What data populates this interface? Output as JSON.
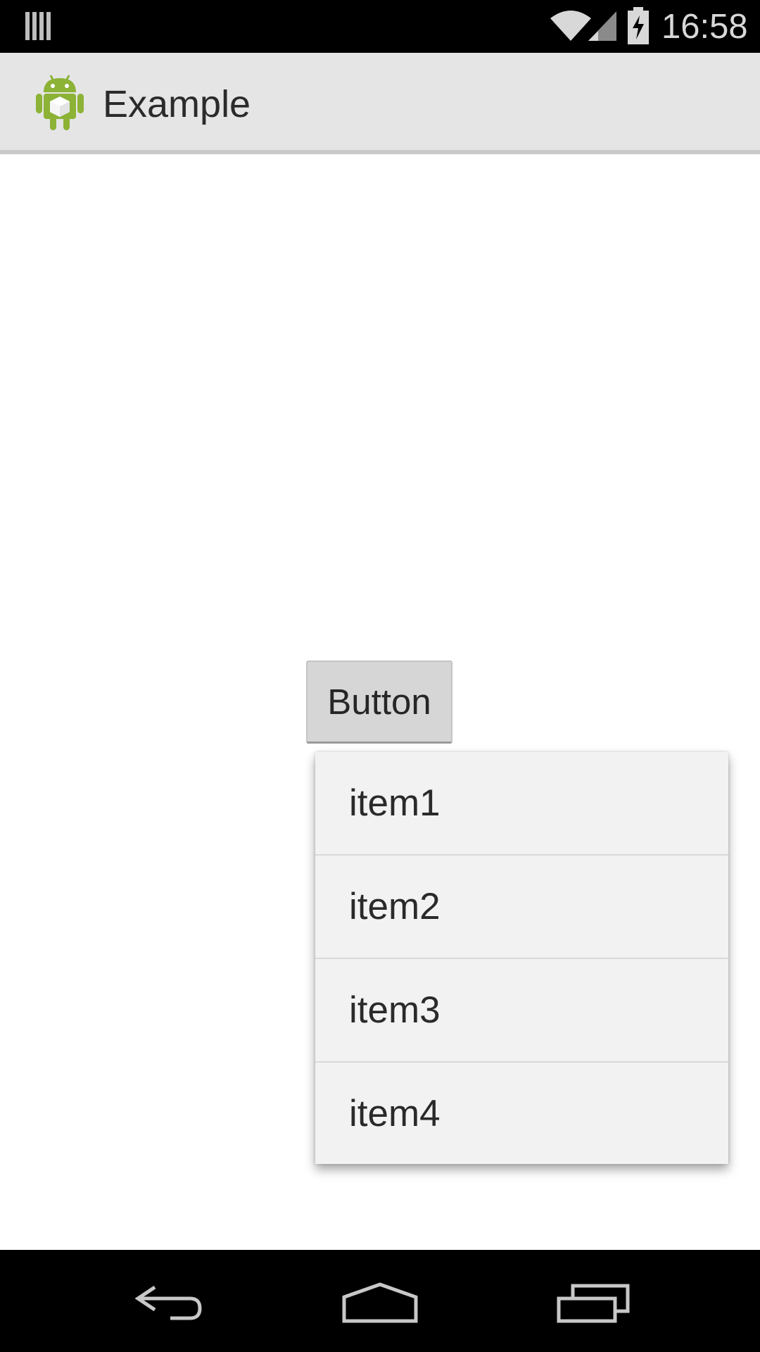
{
  "status_bar": {
    "time": "16:58",
    "icons": [
      "notification-icon",
      "wifi-icon",
      "signal-icon",
      "battery-charging-icon"
    ]
  },
  "action_bar": {
    "app_icon": "android-app-icon",
    "title": "Example"
  },
  "main": {
    "button_label": "Button"
  },
  "popup_menu": {
    "items": [
      {
        "label": "item1"
      },
      {
        "label": "item2"
      },
      {
        "label": "item3"
      },
      {
        "label": "item4"
      }
    ]
  },
  "nav_bar": {
    "icons": [
      "back-icon",
      "home-icon",
      "recents-icon"
    ]
  },
  "colors": {
    "status_bar_bg": "#000000",
    "action_bar_bg": "#e5e5e5",
    "button_bg": "#d6d6d6",
    "menu_bg": "#f2f2f2",
    "android_green": "#8cb236"
  }
}
